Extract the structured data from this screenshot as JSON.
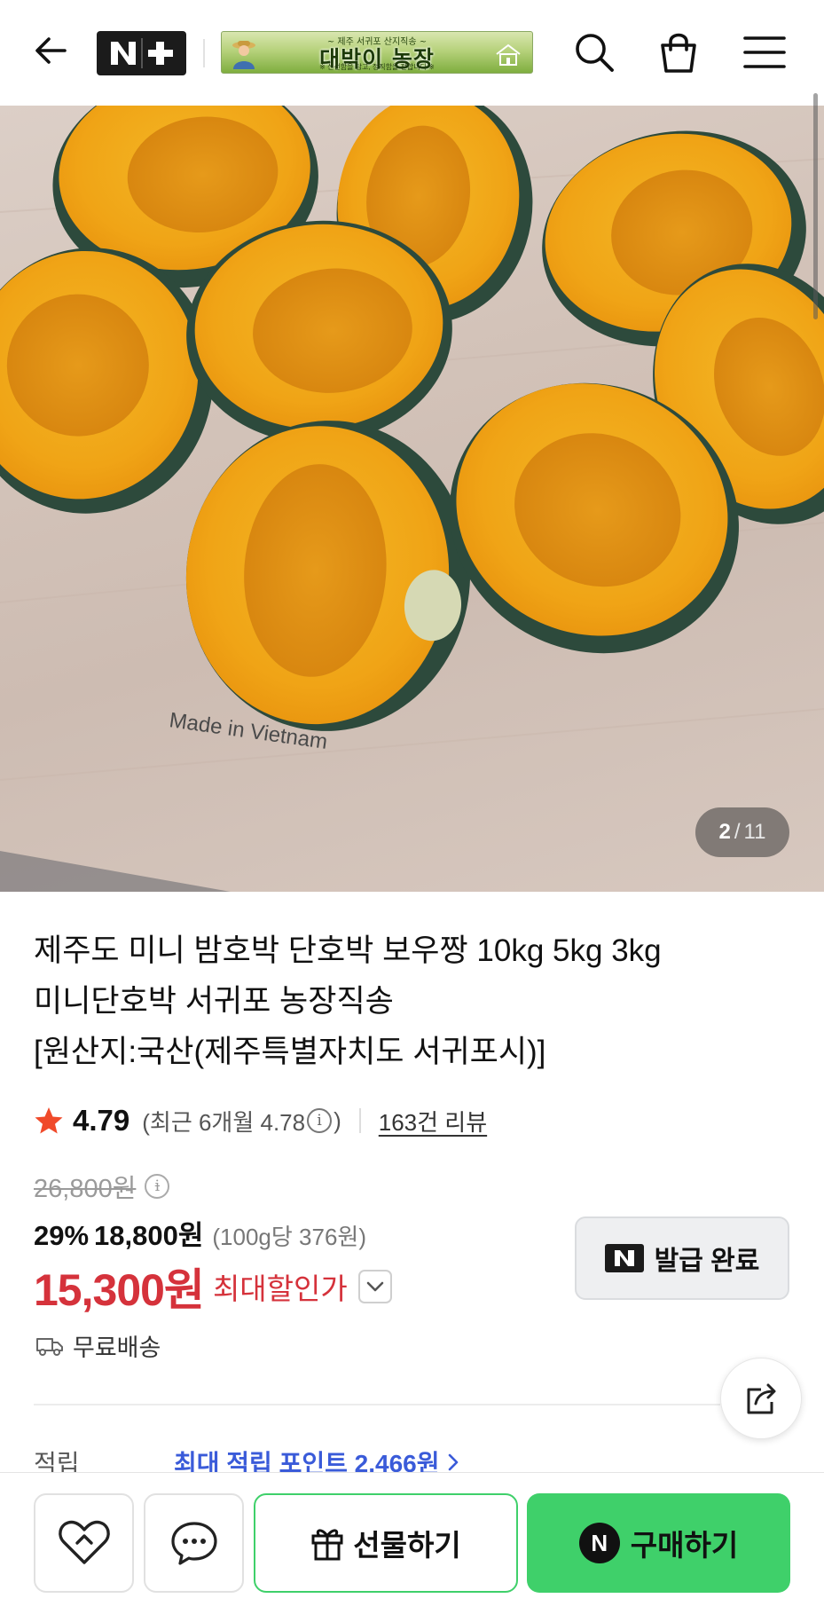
{
  "header": {
    "brand_badge": "N+",
    "banner": {
      "subtitle": "~ 제주 서귀포 산지직송 ~",
      "title": "대박이 농장",
      "footer": "※ 신선함을 담고, 정직함을 전합니다 ※"
    },
    "icons": [
      "back-arrow-icon",
      "search-icon",
      "shopping-bag-icon",
      "menu-icon"
    ]
  },
  "gallery": {
    "current": "2",
    "separator": "/",
    "total": "11",
    "watermark": "Made in Vietnam"
  },
  "product": {
    "title_line1": "제주도 미니 밤호박 단호박 보우짱 10kg 5kg 3kg",
    "title_line2": "미니단호박 서귀포 농장직송",
    "title_line3": "[원산지:국산(제주특별자치도 서귀포시)]",
    "rating": "4.79",
    "recent_prefix": "(최근 6개월 4.78",
    "recent_suffix": ")",
    "reviews": "163건 리뷰",
    "original_price": "26,800원",
    "discount_rate": "29%",
    "discount_price": "18,800원",
    "unit_price": "(100g당 376원)",
    "max_price": "15,300원",
    "max_label": "최대할인가",
    "coupon_label": "발급 완료",
    "shipping": "무료배송",
    "points_label": "적립",
    "points_value": "최대 적립 포인트 2,466원"
  },
  "bottom_bar": {
    "gift_label": "선물하기",
    "buy_label": "구매하기",
    "buy_badge": "N"
  },
  "colors": {
    "accent_green": "#3fd06a",
    "sale_red": "#d5323b",
    "link_blue": "#3a5bd9",
    "star": "#f04a2a"
  }
}
